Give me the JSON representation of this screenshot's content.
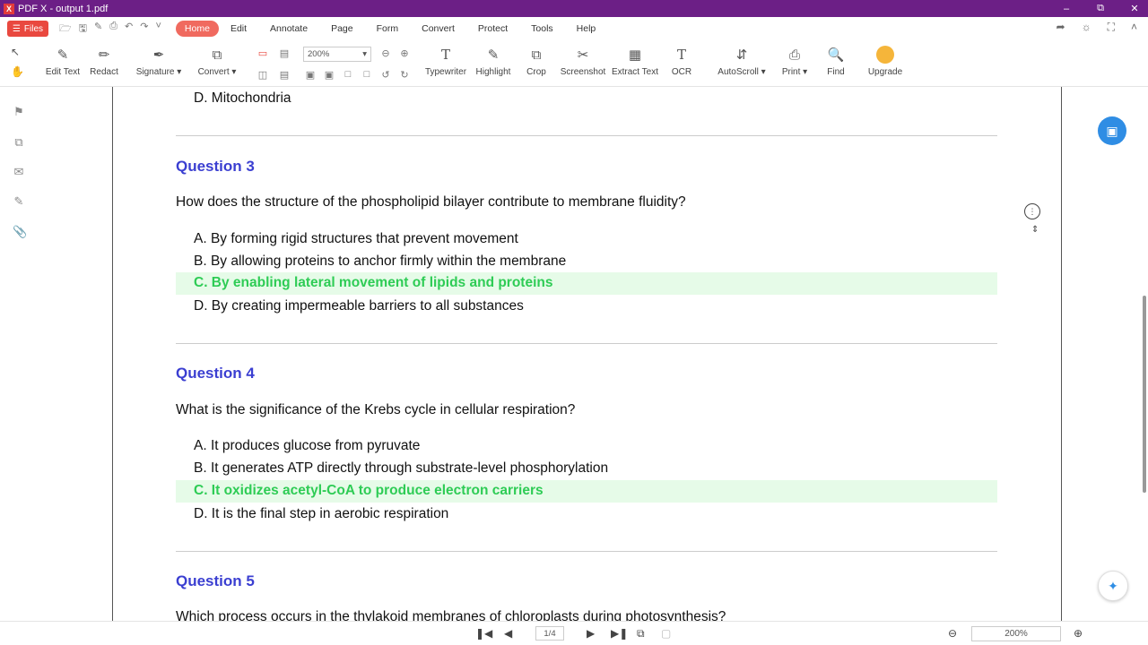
{
  "window": {
    "title": "PDF X - output 1.pdf",
    "logo": "X",
    "controls": [
      "minimize-icon",
      "restore-icon",
      "close-icon"
    ]
  },
  "menu": {
    "files_label": "Files",
    "items": [
      {
        "label": "Home",
        "active": true
      },
      {
        "label": "Edit"
      },
      {
        "label": "Annotate"
      },
      {
        "label": "Page"
      },
      {
        "label": "Form"
      },
      {
        "label": "Convert"
      },
      {
        "label": "Protect"
      },
      {
        "label": "Tools"
      },
      {
        "label": "Help"
      }
    ]
  },
  "toolbar": {
    "edit_text": "Edit Text",
    "redact": "Redact",
    "signature": "Signature",
    "convert": "Convert",
    "zoom_value": "200%",
    "typewriter": "Typewriter",
    "highlight": "Highlight",
    "crop": "Crop",
    "screenshot": "Screenshot",
    "extract_text": "Extract Text",
    "ocr": "OCR",
    "autoscroll": "AutoScroll",
    "print": "Print",
    "find": "Find",
    "upgrade": "Upgrade"
  },
  "document": {
    "prev_option": "D. Mitochondria",
    "questions": [
      {
        "title": "Question 3",
        "text": "How does the structure of the phospholipid bilayer contribute to membrane fluidity?",
        "options": [
          "A. By forming rigid structures that prevent movement",
          "B. By allowing proteins to anchor firmly within the membrane",
          "C. By enabling lateral movement of lipids and proteins",
          "D. By creating impermeable barriers to all substances"
        ],
        "correct_index": 2
      },
      {
        "title": "Question 4",
        "text": "What is the significance of the Krebs cycle in cellular respiration?",
        "options": [
          "A. It produces glucose from pyruvate",
          "B. It generates ATP directly through substrate-level phosphorylation",
          "C. It oxidizes acetyl-CoA to produce electron carriers",
          "D. It is the final step in aerobic respiration"
        ],
        "correct_index": 2
      },
      {
        "title": "Question 5",
        "text": "Which process occurs in the thylakoid membranes of chloroplasts during photosynthesis?"
      }
    ]
  },
  "status": {
    "page_indicator": "1/4",
    "zoom": "200%"
  },
  "colors": {
    "titlebar": "#6c1f86",
    "accent": "#e9483f",
    "question_title": "#3b3fd1",
    "correct_text": "#2ecc55",
    "correct_bg": "#e6fbe8"
  }
}
